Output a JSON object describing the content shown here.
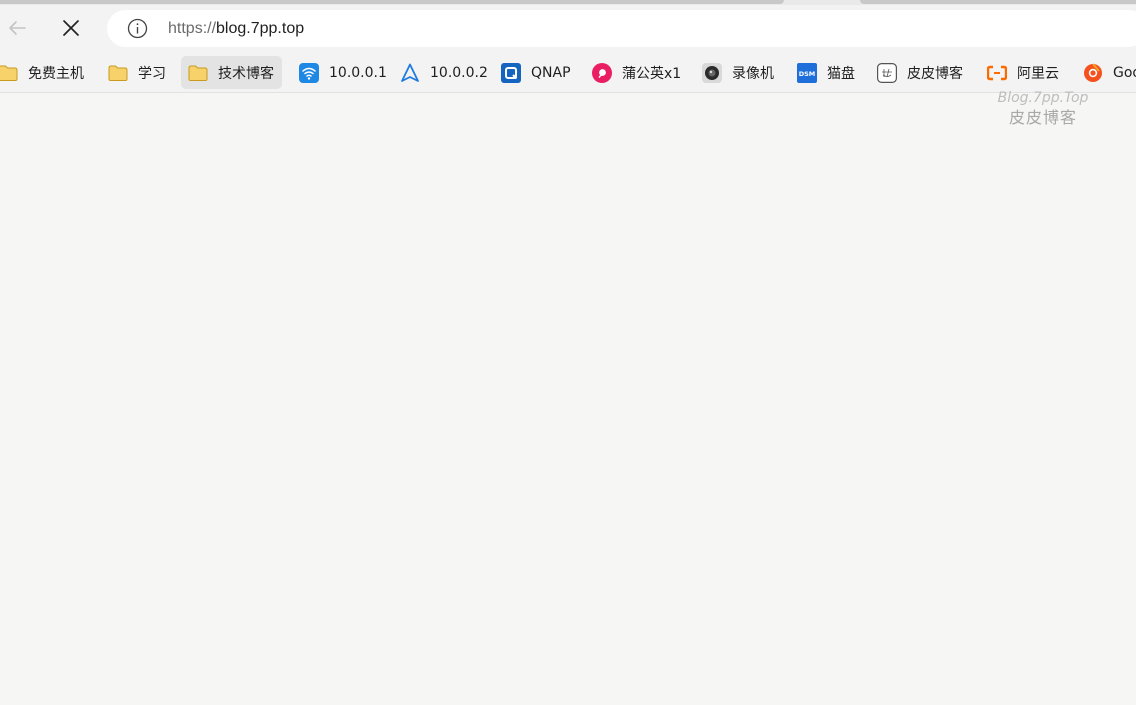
{
  "address": {
    "scheme": "https://",
    "host": "blog.7pp.top"
  },
  "bookmarks": [
    {
      "label": "免费主机",
      "icon": "folder-icon"
    },
    {
      "label": "学习",
      "icon": "folder-icon"
    },
    {
      "label": "技术博客",
      "icon": "folder-icon"
    },
    {
      "label": "10.0.0.1",
      "icon": "wifi-icon"
    },
    {
      "label": "10.0.0.2",
      "icon": "arrow-nav-icon"
    },
    {
      "label": "QNAP",
      "icon": "qnap-icon"
    },
    {
      "label": "蒲公英x1",
      "icon": "dandelion-icon"
    },
    {
      "label": "录像机",
      "icon": "camera-icon"
    },
    {
      "label": "猫盘",
      "icon": "dsm-icon"
    },
    {
      "label": "皮皮博客",
      "icon": "pipi-blog-icon"
    },
    {
      "label": "阿里云",
      "icon": "aliyun-icon"
    },
    {
      "label": "Goo",
      "icon": "google-icon"
    }
  ],
  "watermark": {
    "line1": "Blog.7pp.Top",
    "line2": "皮皮博客"
  },
  "colors": {
    "page_background": "#f6f6f4",
    "toolbar_background": "#f3f3f3",
    "folder_yellow": "#f4c430",
    "wifi_blue": "#1e88e5",
    "qnap_blue": "#1565c0",
    "dandelion_red": "#e91e63",
    "aliyun_orange": "#ff6a00",
    "google_orange": "#f4511e"
  }
}
